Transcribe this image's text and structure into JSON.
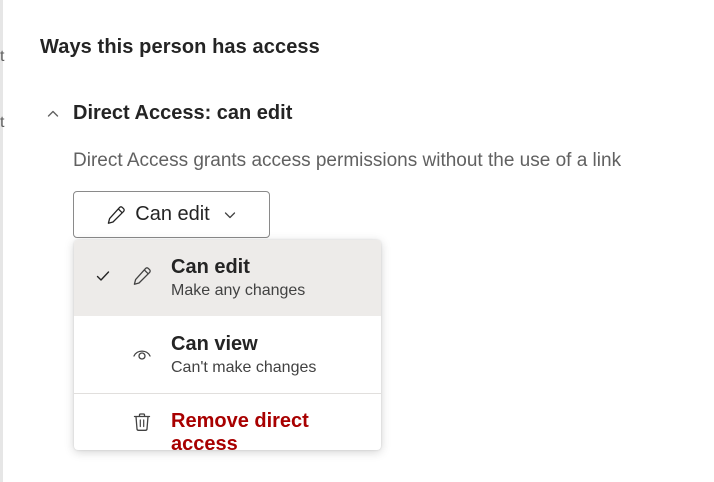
{
  "panel": {
    "heading": "Ways this person has access",
    "edge_chars": [
      "t",
      "t"
    ]
  },
  "direct_access": {
    "title": "Direct Access: can edit",
    "description": "Direct Access grants access permissions without the use of a link"
  },
  "permission_button": {
    "label": "Can edit",
    "icon": "pencil-icon"
  },
  "menu": {
    "items": [
      {
        "title": "Can edit",
        "subtitle": "Make any changes",
        "icon": "pencil-icon",
        "selected": true
      },
      {
        "title": "Can view",
        "subtitle": "Can't make changes",
        "icon": "eye-icon",
        "selected": false
      }
    ],
    "remove": {
      "label": "Remove direct access",
      "icon": "trash-icon",
      "color": "#a80000"
    }
  },
  "colors": {
    "selected_bg": "#edebe9",
    "danger": "#a80000",
    "muted_text": "#616161"
  }
}
